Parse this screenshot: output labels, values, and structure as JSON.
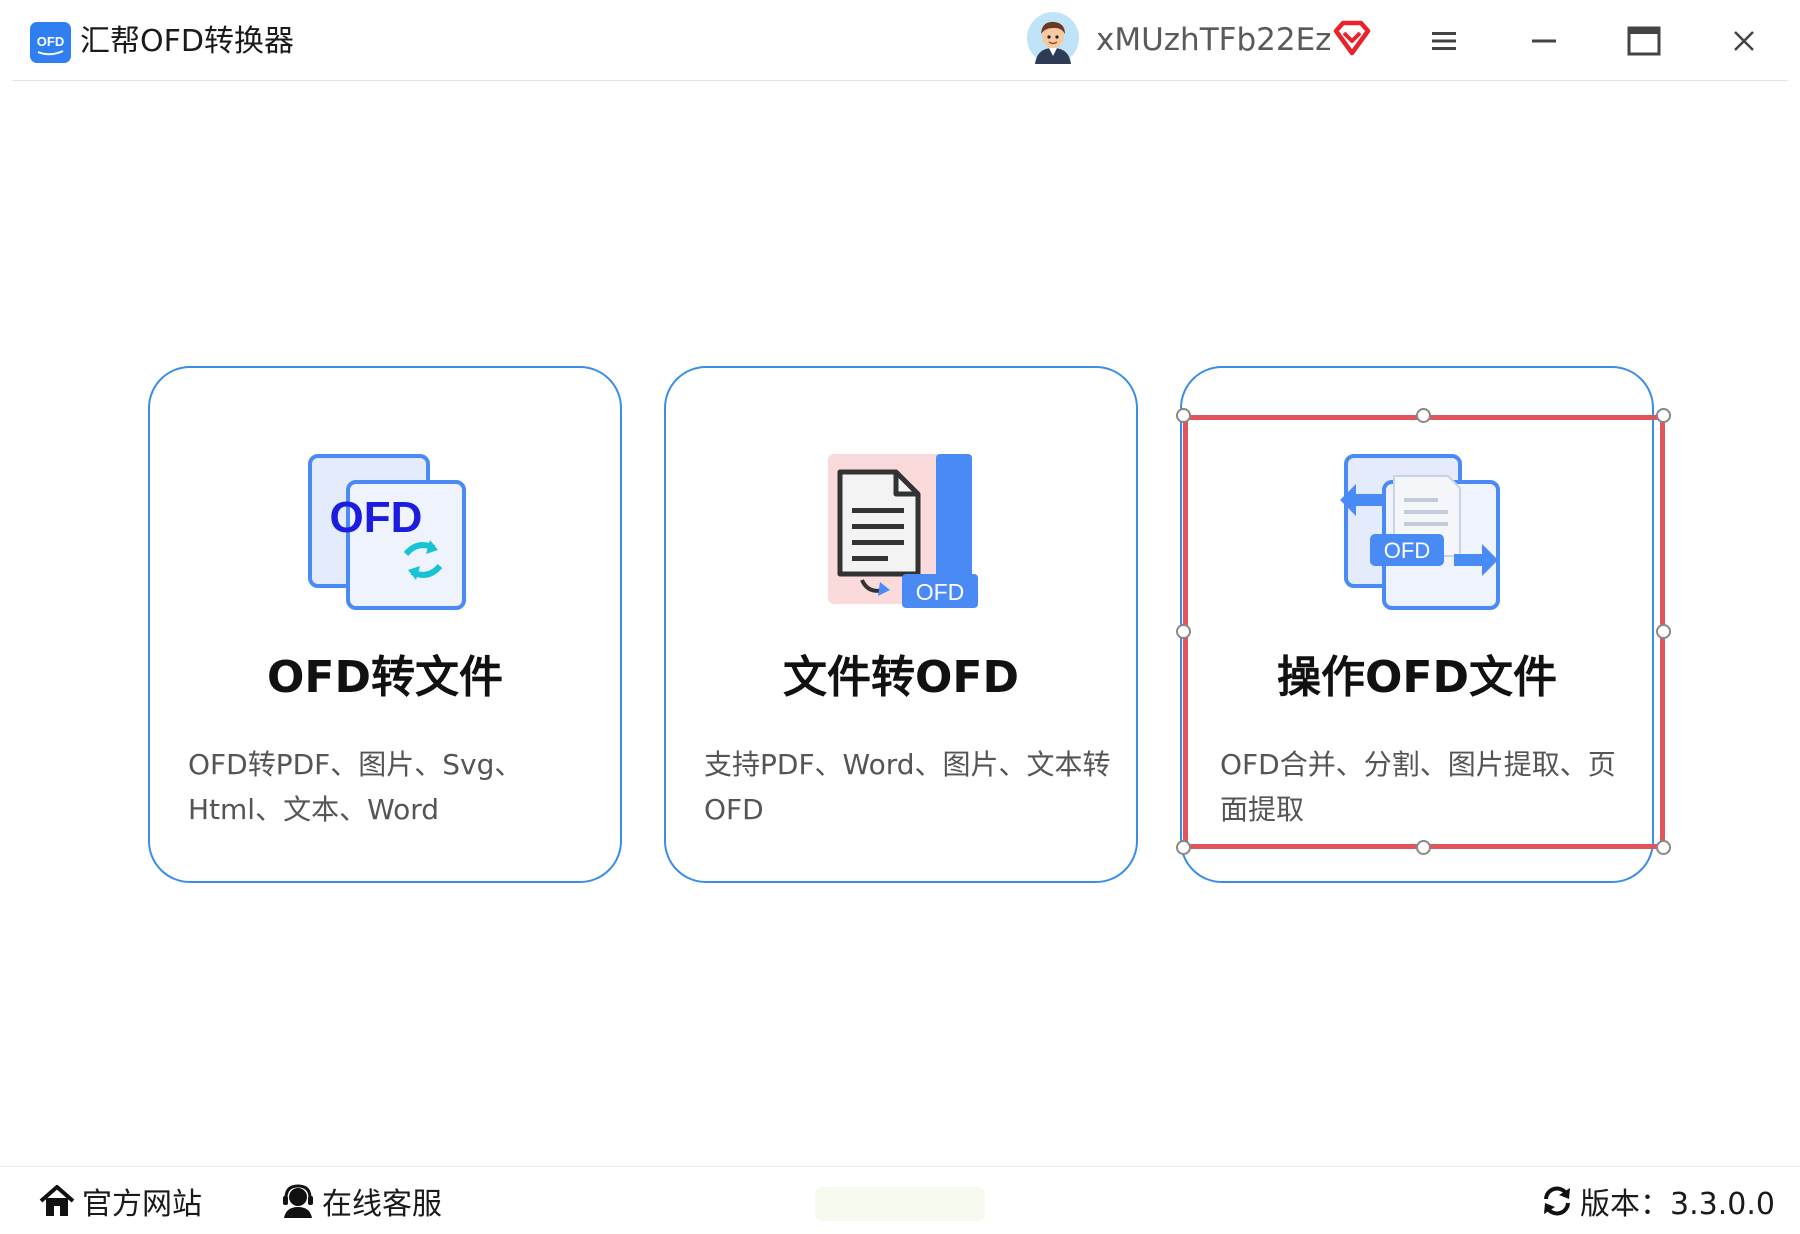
{
  "titlebar": {
    "app_title": "汇帮OFD转换器",
    "logo_text": "OFD",
    "username": "xMUzhTFb22Ez",
    "icons": [
      "app-logo-icon",
      "avatar-icon",
      "vip-diamond-icon",
      "menu-icon",
      "minimize-icon",
      "maximize-icon",
      "close-icon"
    ]
  },
  "cards": [
    {
      "title": "OFD转文件",
      "desc": "OFD转PDF、图片、Svg、Html、文本、Word",
      "icon": "ofd-to-file-icon",
      "icon_text": "OFD"
    },
    {
      "title": "文件转OFD",
      "desc": "支持PDF、Word、图片、文本转OFD",
      "icon": "file-to-ofd-icon",
      "icon_text": "OFD"
    },
    {
      "title": "操作OFD文件",
      "desc": "OFD合并、分割、图片提取、页面提取",
      "icon": "operate-ofd-icon",
      "icon_text": "OFD"
    }
  ],
  "footer": {
    "website": "官方网站",
    "support": "在线客服",
    "version": "版本：3.3.0.0"
  },
  "colors": {
    "card_border": "#3a8ee6",
    "accent_blue": "#4a8af4",
    "selection": "#e0555a",
    "vip": "#e8232c"
  }
}
